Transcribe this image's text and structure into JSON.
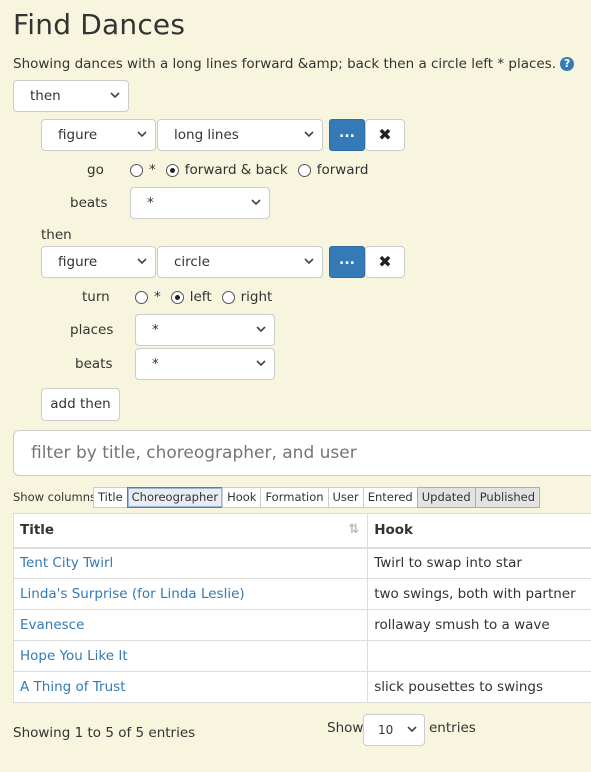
{
  "page": {
    "title": "Find Dances",
    "description": "Showing dances with a long lines forward &amp; back then a circle left * places.",
    "help_icon": "question-circle-icon",
    "accent": "#337ab7",
    "background": "#f7f5dd"
  },
  "query": {
    "root_operator": "then",
    "figure1": {
      "kind": "figure",
      "move": "long lines",
      "dots_label": "...",
      "remove_icon": "✖",
      "go_label": "go",
      "go_options": [
        "*",
        "forward & back",
        "forward"
      ],
      "go_selected": "forward & back",
      "beats_label": "beats",
      "beats_value": "*"
    },
    "then_label": "then",
    "figure2": {
      "kind": "figure",
      "move": "circle",
      "dots_label": "...",
      "remove_icon": "✖",
      "turn_label": "turn",
      "turn_options": [
        "*",
        "left",
        "right"
      ],
      "turn_selected": "left",
      "places_label": "places",
      "places_value": "*",
      "beats_label": "beats",
      "beats_value": "*"
    },
    "add_then_label": "add then"
  },
  "filter": {
    "placeholder": "filter by title, choreographer, and user"
  },
  "columns": {
    "label": "Show columns",
    "toggles": [
      "Title",
      "Choreographer",
      "Hook",
      "Formation",
      "User",
      "Entered",
      "Updated",
      "Published"
    ]
  },
  "table": {
    "headers": [
      "Title",
      "Hook"
    ],
    "rows": [
      {
        "title": "Tent City Twirl",
        "hook": "Twirl to swap into star"
      },
      {
        "title": "Linda's Surprise (for Linda Leslie)",
        "hook": "two swings, both with partner"
      },
      {
        "title": "Evanesce",
        "hook": "rollaway smush to a wave"
      },
      {
        "title": "Hope You Like It",
        "hook": ""
      },
      {
        "title": "A Thing of Trust",
        "hook": "slick pousettes to swings"
      }
    ]
  },
  "pagination": {
    "info": "Showing 1 to 5 of 5 entries",
    "show_label": "Show",
    "length_value": "10",
    "entries_label": "entries"
  }
}
